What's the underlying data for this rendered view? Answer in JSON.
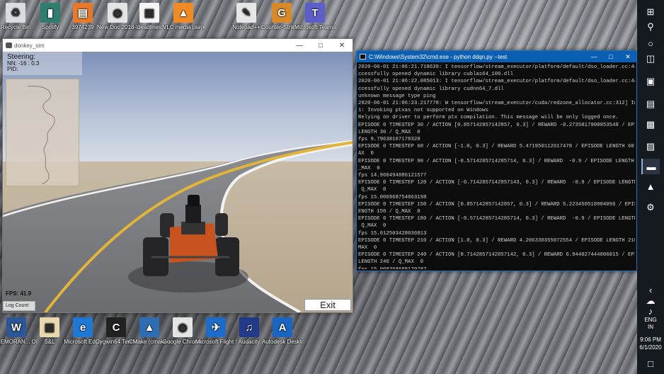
{
  "desktop_icons_top": [
    {
      "label": "Recycle Bin",
      "icon": "recycle-bin-icon",
      "color": "#d9dde2",
      "glyph": "♻"
    },
    {
      "label": "Spotify",
      "icon": "folder-app-icon",
      "color": "#2f7d6f",
      "glyph": "▮"
    },
    {
      "label": "3974239",
      "icon": "file-icon",
      "color": "#e8792a",
      "glyph": "▤"
    },
    {
      "label": "New Doc 2018-08-23",
      "icon": "chrome-icon",
      "color": "#e4e4e4",
      "glyph": "◉"
    },
    {
      "label": "deadlines",
      "icon": "text-file-icon",
      "color": "#f4f4f4",
      "glyph": "▤"
    },
    {
      "label": "VLC media player",
      "icon": "vlc-icon",
      "color": "#f08a24",
      "glyph": "▲"
    },
    {
      "label": "Notepad++",
      "icon": "notepad-icon",
      "color": "#e6e6e6",
      "glyph": "✎"
    },
    {
      "label": "Counter-Strike Global Offe...",
      "icon": "csgo-icon",
      "color": "#d8892a",
      "glyph": "G"
    },
    {
      "label": "Microsoft Teams",
      "icon": "teams-icon",
      "color": "#5b5fc7",
      "glyph": "T"
    }
  ],
  "desktop_icons_bottom": [
    {
      "label": "MEMORAN... OF UNDER...",
      "icon": "word-doc-icon",
      "color": "#2b5797",
      "glyph": "W"
    },
    {
      "label": "S&L",
      "icon": "document-icon",
      "color": "#e8d9b0",
      "glyph": "▤"
    },
    {
      "label": "Microsoft Edge",
      "icon": "edge-icon",
      "color": "#1e78d4",
      "glyph": "e"
    },
    {
      "label": "Cygwin64 Terminal",
      "icon": "terminal-icon",
      "color": "#222222",
      "glyph": "C"
    },
    {
      "label": "CMake (cmake-gui)",
      "icon": "cmake-icon",
      "color": "#2f6db3",
      "glyph": "▲"
    },
    {
      "label": "Google Chrome",
      "icon": "chrome-icon",
      "color": "#e4e4e4",
      "glyph": "◉"
    },
    {
      "label": "Microsoft Flight Sim...",
      "icon": "flight-sim-icon",
      "color": "#1d6cc9",
      "glyph": "✈"
    },
    {
      "label": "Audacity",
      "icon": "audacity-icon",
      "color": "#223a8a",
      "glyph": "♫"
    },
    {
      "label": "Autodesk Desktop App",
      "icon": "autodesk-icon",
      "color": "#1a64c2",
      "glyph": "A"
    }
  ],
  "sim_window": {
    "title": "donkey_sim",
    "hud": {
      "steering_label": "Steering:",
      "nn_label": "NN: -16 : 0.3",
      "pid_label": "PID:"
    },
    "fps_label": "FPS: 41.9",
    "log_count_label": "Log Count",
    "exit_label": "Exit"
  },
  "cmd_window": {
    "title": "C:\\Windows\\System32\\cmd.exe - python  ddqn.py  --test",
    "lines": [
      "2020-06-01 21:06:21.718639: I tensorflow/stream_executor/platform/default/dso_loader.cc:44",
      "ccessfully opened dynamic library cublas64_100.dll",
      "2020-06-01 21:06:22.085013: I tensorflow/stream_executor/platform/default/dso_loader.cc:44",
      "ccessfully opened dynamic library cudnn64_7.dll",
      "unknown message type ping",
      "2020-06-01 21:06:23.217778: W tensorflow/stream_executor/cuda/redzone_allocator.cc:312] In",
      "1: Invoking ptxas not supported on Windows",
      "Relying on driver to perform ptx compilation. This message will be only logged once.",
      "EPISODE 0 TIMESTEP 30 / ACTION [0.857142857142857, 0.3] / REWARD -0.2735817900053548 / EPIS",
      "LENGTH 30 / Q_MAX  0",
      "fps 9.79638107178328",
      "EPISODE 0 TIMESTEP 60 / ACTION [-1.0, 0.3] / REWARD 5.471950112617478 / EPISODE LENGTH 60",
      "AX  0",
      "EPISODE 0 TIMESTEP 90 / ACTION [-0.5714285714285714, 0.3] / REWARD  -0.9 / EPISODE LENGTH 9",
      "_MAX  0",
      "fps 14.960494886121577",
      "EPISODE 0 TIMESTEP 120 / ACTION [-0.7142857142857143, 0.3] / REWARD  -0.9 / EPISODE LENGTH",
      " Q_MAX  0",
      "fps 15.006968754063198",
      "EPISODE 0 TIMESTEP 150 / ACTION [0.857142857142857, 0.3] / REWARD 5.223450518904096 / EPIS",
      "ENGTH 150 / Q_MAX  0",
      "EPISODE 0 TIMESTEP 180 / ACTION [-0.5714285714285714, 0.3] / REWARD  -0.9 / EPISODE LENGTH",
      " Q_MAX  0",
      "fps 15.012503428036013",
      "EPISODE 0 TIMESTEP 210 / ACTION [1.0, 0.3] / REWARD 4.206330355072554 / EPISODE LENGTH 210",
      "MAX  0",
      "EPISODE 0 TIMESTEP 240 / ACTION [0.7142857142857142, 0.3] / REWARD 6.944027444006015 / EPI",
      "LENGTH 240 / Q_MAX  0",
      "fps 15.008368688170782"
    ]
  },
  "taskbar": {
    "lang_line1": "ENG",
    "lang_line2": "IN",
    "time": "9:06 PM",
    "date": "6/1/2020"
  }
}
